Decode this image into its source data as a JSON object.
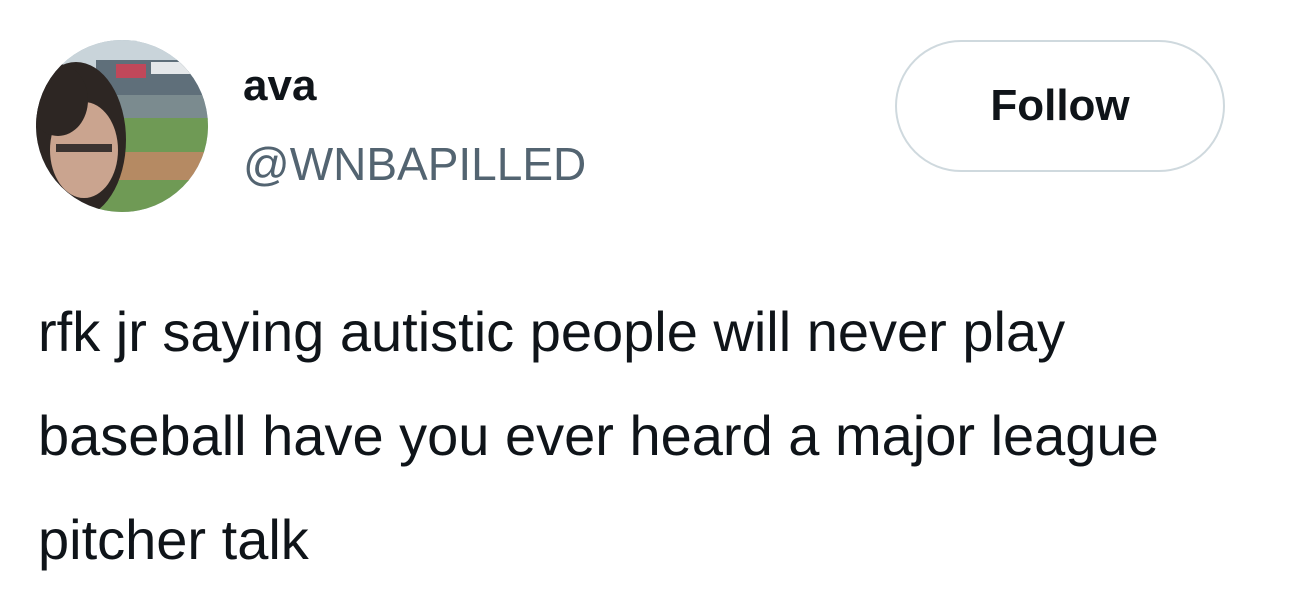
{
  "author": {
    "display_name": "ava",
    "handle": "@WNBAPILLED",
    "avatar_icon": "profile-photo-stadium"
  },
  "follow_button": {
    "label": "Follow"
  },
  "tweet": {
    "text": "rfk jr saying autistic people will never play baseball have you ever heard a major league pitcher talk"
  },
  "colors": {
    "text_primary": "#0f1419",
    "text_secondary": "#536471",
    "button_border": "#cfd9de",
    "background": "#ffffff"
  }
}
